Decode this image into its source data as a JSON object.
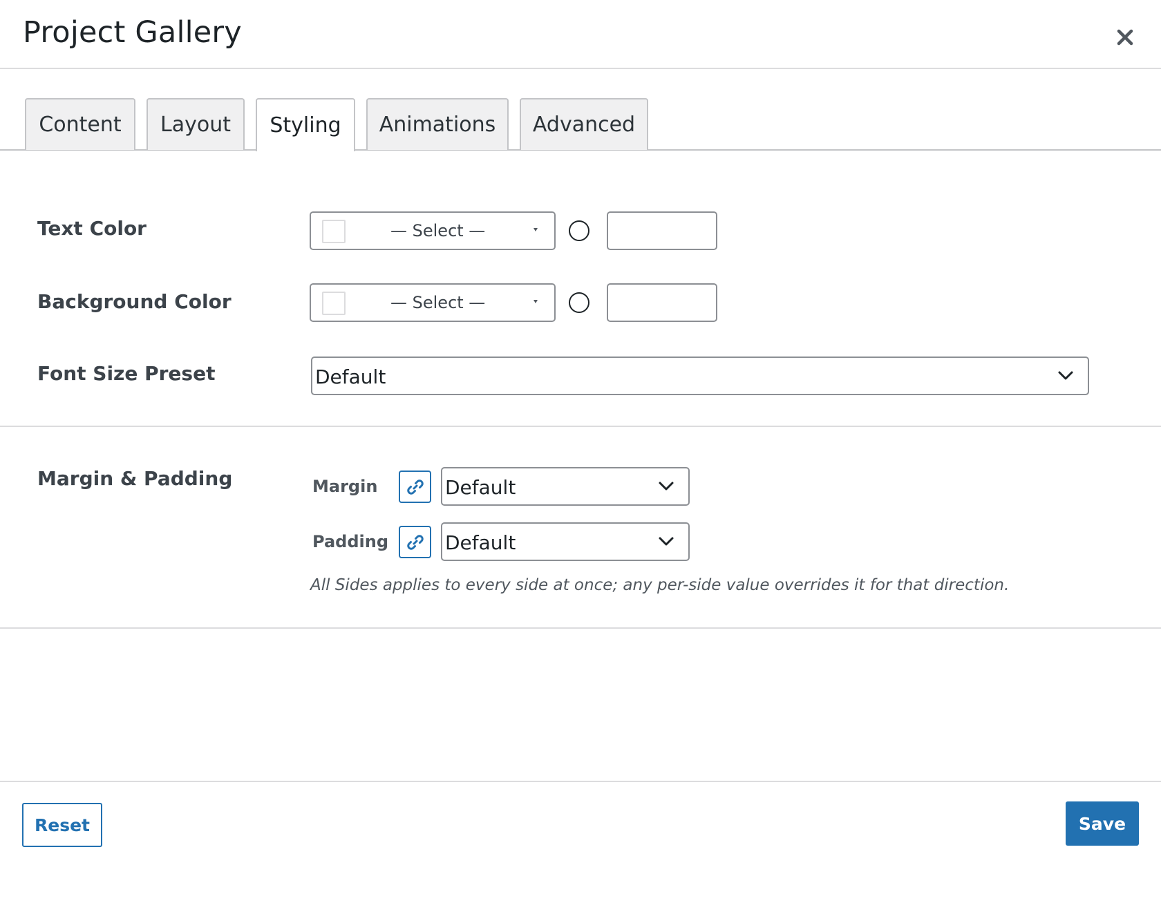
{
  "modal": {
    "title": "Project Gallery",
    "close_icon": "close-icon"
  },
  "tabs": [
    {
      "label": "Content",
      "active": false
    },
    {
      "label": "Layout",
      "active": false
    },
    {
      "label": "Styling",
      "active": true
    },
    {
      "label": "Animations",
      "active": false
    },
    {
      "label": "Advanced",
      "active": false
    }
  ],
  "styling": {
    "text_color": {
      "label": "Text Color",
      "select_label": "— Select —",
      "hex_value": ""
    },
    "background_color": {
      "label": "Background Color",
      "select_label": "— Select —",
      "hex_value": ""
    },
    "font_size_preset": {
      "label": "Font Size Preset",
      "value": "Default"
    },
    "spacing": {
      "label": "Margin & Padding",
      "margin_label": "Margin",
      "margin_value": "Default",
      "padding_label": "Padding",
      "padding_value": "Default",
      "help_text": "All Sides applies to every side at once; any per-side value overrides it for that direction."
    }
  },
  "footer": {
    "reset_label": "Reset",
    "save_label": "Save"
  },
  "colors": {
    "accent": "#2271b1",
    "border": "#8c8f94",
    "divider": "#dcdcde",
    "tab_inactive_bg": "#f0f0f1"
  }
}
